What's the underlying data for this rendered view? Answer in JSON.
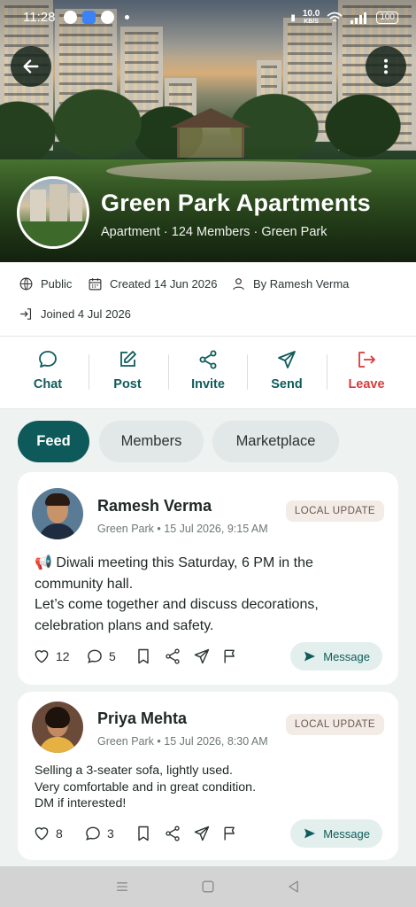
{
  "status_bar": {
    "time": "11:28",
    "speed_value": "10.0",
    "speed_unit": "KB/S",
    "battery": "100"
  },
  "group": {
    "name": "Green Park Apartments",
    "subtitle": "Apartment · 124 Members · Green Park"
  },
  "info": {
    "visibility": "Public",
    "created": "Created 14 Jun 2026",
    "creator": "By Ramesh Verma",
    "joined": "Joined 4 Jul 2026"
  },
  "actions": [
    {
      "label": "Chat",
      "icon": "chat-bubble-icon"
    },
    {
      "label": "Post",
      "icon": "edit-icon"
    },
    {
      "label": "Invite",
      "icon": "share-icon"
    },
    {
      "label": "Send",
      "icon": "send-icon"
    },
    {
      "label": "Leave",
      "icon": "logout-icon",
      "color": "#d83b3b"
    }
  ],
  "tabs": [
    {
      "label": "Feed",
      "active": true
    },
    {
      "label": "Members",
      "active": false
    },
    {
      "label": "Marketplace",
      "active": false
    }
  ],
  "posts": [
    {
      "author": "Ramesh Verma",
      "meta": "Green Park • 15 Jul 2026, 9:15 AM",
      "badge": "LOCAL UPDATE",
      "lines": [
        "📢 Diwali meeting this Saturday, 6 PM in the",
        "community hall.",
        "Let’s come together and discuss decorations,",
        "celebration plans and safety."
      ],
      "likes": "12",
      "comments": "5",
      "message_label": "Message"
    },
    {
      "author": "Priya Mehta",
      "meta": "Green Park • 15 Jul 2026, 8:30 AM",
      "badge": "LOCAL UPDATE",
      "lines": [
        "Selling a 3-seater sofa, lightly used.",
        "Very comfortable and in great condition.",
        "DM if interested!"
      ],
      "likes": "8",
      "comments": "3",
      "message_label": "Message"
    }
  ],
  "colors": {
    "primary": "#0e5a5a",
    "danger": "#d83b3b",
    "badge_bg": "#f3ebe5"
  }
}
